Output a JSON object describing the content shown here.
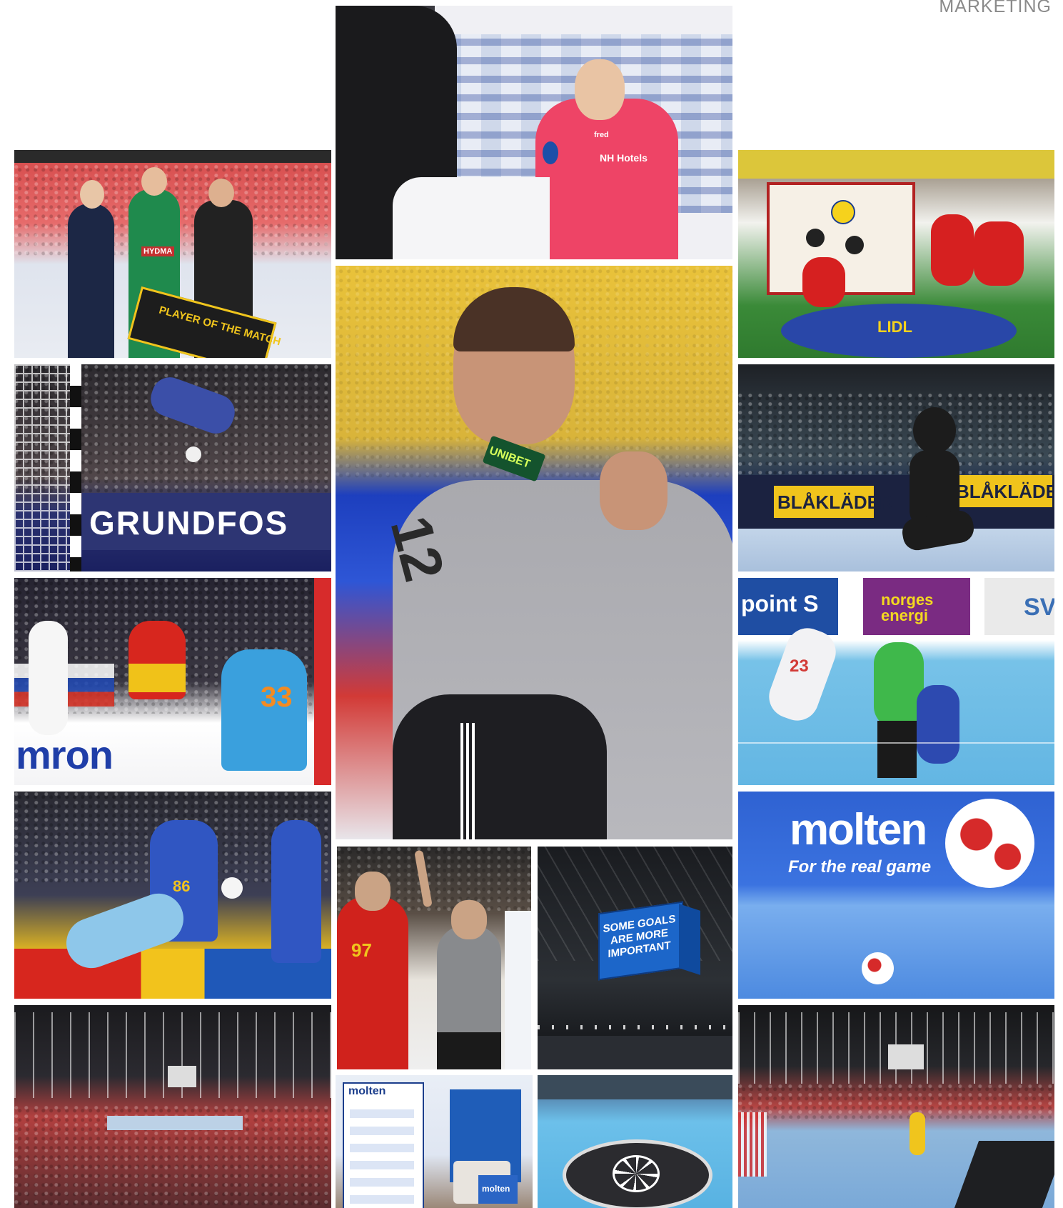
{
  "header": {
    "label": "MARKETING"
  },
  "photos": {
    "player_of_match": {
      "alt": "Player of the match award ceremony",
      "sign_text": "PLAYER OF THE MATCH",
      "sponsor_text": "HYDMA"
    },
    "interview": {
      "alt": "Player interview in front of sponsor wall",
      "shirt_text": "NH Hotels",
      "mic_text": "fred"
    },
    "goalkeeper_celebration": {
      "alt": "Goalkeeper celebrating",
      "patch_text": "UNIBET",
      "number": "12"
    },
    "fan_activation": {
      "alt": "Sponsor fan activation booth",
      "brand_text": "LIDL"
    },
    "grundfos_save": {
      "alt": "Goalkeeper diving in front of advertising board",
      "board_text": "GRUNDFOS"
    },
    "mascot_arena": {
      "alt": "Mascot in front of arena board",
      "board_text_left": "BLÅKLÄDER",
      "board_text_right": "BLÅKLÄDER"
    },
    "spain_attack": {
      "alt": "Player jumping to shoot",
      "board_text": "mron",
      "number": "33"
    },
    "norway_shot": {
      "alt": "Jump shot on blue court",
      "board_text_left": "point S",
      "board_text_mid": "norges energi",
      "board_text_right": "SV",
      "number": "23"
    },
    "argentina_shot": {
      "alt": "Player shooting between defenders",
      "number": "86"
    },
    "molten_ball": {
      "alt": "Molten ball on court",
      "brand_text": "molten",
      "tagline": "For the real game"
    },
    "arena_crowd": {
      "alt": "Full arena with crowd"
    },
    "referee": {
      "alt": "Referee signalling",
      "number": "97"
    },
    "scoreboard": {
      "alt": "Scoreboard cube with message",
      "message": "SOME GOALS ARE MORE IMPORTANT"
    },
    "molten_display": {
      "alt": "Molten ball display stand",
      "brand_text": "molten"
    },
    "court_logo": {
      "alt": "Court with center logo"
    },
    "arena_wide": {
      "alt": "Wide arena view during match"
    }
  },
  "colors": {
    "label": "#8a8a8a",
    "court_blue": "#4aa8de",
    "danish_red": "#c8202f",
    "swedish_yellow": "#f2c81c"
  }
}
